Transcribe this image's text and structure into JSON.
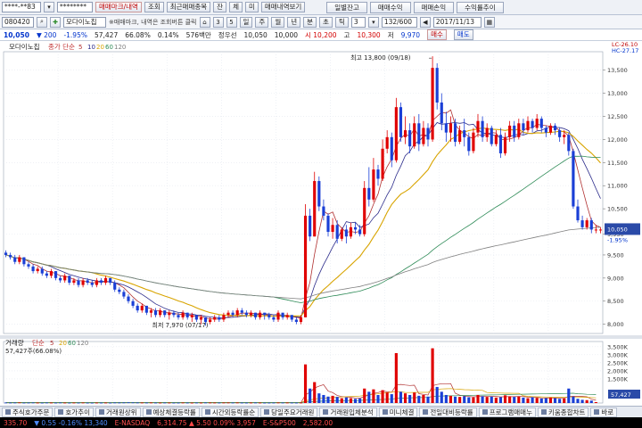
{
  "toolbar1": {
    "account": "****-**83",
    "password": "********",
    "btn_trade": "매매마크/내역",
    "btn_query": "조회",
    "btn_recent": "최근매매종목",
    "btn_balance": "잔",
    "btn_orders": "체",
    "btn_unfilled": "미",
    "btn_tradehist": "매매내역보기",
    "btn_daily": "일별잔고",
    "btn_profit": "매매수익",
    "btn_tradeprofit": "매매손익",
    "btn_yield": "수익률추이"
  },
  "toolbar2": {
    "code": "080420",
    "name": "모다이노칩",
    "note": "※매매마크, 내역은 조회버튼 클릭",
    "icon_labels": [
      "⌂",
      "3",
      "5"
    ],
    "btn_week": "일",
    "btn_min": "주",
    "btn_month": "월",
    "btn_year": "년",
    "btn_tick": "분",
    "btn_sec": "초",
    "btn_t": "틱",
    "min_value": "3",
    "count": "132/600",
    "date": "2017/11/13"
  },
  "quote": {
    "price": "10,050",
    "change": "200",
    "change_rate": "-1.95%",
    "volume": "57,427",
    "vol_ratio": "66.08%",
    "turnover": "0.14%",
    "amount": "576백만",
    "info": "정우선",
    "o": "10,050",
    "h": "10,000",
    "l": "시 10,200",
    "c_label": "고",
    "high": "10,300",
    "low_label": "저",
    "low": "9,970",
    "buy": "매수",
    "sell": "매도"
  },
  "price_panel": {
    "title": "모다이노칩",
    "ma_label": "종가 단순",
    "ma_periods": [
      "5",
      "10",
      "20",
      "60",
      "120"
    ],
    "lc_label": "LC-26.10",
    "hc_label": "HC-27.17",
    "high_annotation": "최고 13,800 (09/18)",
    "low_annotation": "최저 7,970 (07/17)",
    "last_price": "10,050",
    "last_rate": "-1.95%",
    "y_ticks": [
      "13,500",
      "13,000",
      "12,500",
      "12,000",
      "11,500",
      "11,000",
      "10,500",
      "9,950",
      "9,500",
      "9,000",
      "8,500",
      "8,000"
    ]
  },
  "volume_panel": {
    "title": "거래량",
    "ma_label": "단순",
    "ma_periods": [
      "5",
      "20",
      "60",
      "120"
    ],
    "value_label": "57,427주(66.08%)",
    "y_ticks": [
      "3,500K",
      "3,000K",
      "2,500K",
      "2,000K",
      "1,500K"
    ],
    "last_value": "57,427"
  },
  "tabs": [
    {
      "label": "주식호가주문"
    },
    {
      "label": "호가추이"
    },
    {
      "label": "거래원상위"
    },
    {
      "label": "예상체결등락률"
    },
    {
      "label": "시간외등락률순"
    },
    {
      "label": "당일주요거래원"
    },
    {
      "label": "거래원입체분석"
    },
    {
      "label": "미니체결"
    },
    {
      "label": "전일대비등락률"
    },
    {
      "label": "프로그램매매누"
    },
    {
      "label": "키움종합차트"
    },
    {
      "label": "바로"
    }
  ],
  "ticker": [
    {
      "text": "335.70",
      "cls": "tup"
    },
    {
      "text": "▼ 0.55  -0.16%  13,340",
      "cls": "tdn"
    },
    {
      "text": "E-NASDAQ",
      "cls": "tname"
    },
    {
      "text": "6,314.75  ▲ 5.50  0.09%  3,957",
      "cls": "tup"
    },
    {
      "text": "E-S&P500",
      "cls": "tname"
    },
    {
      "text": "2,582.00",
      "cls": "tup"
    }
  ],
  "colors": {
    "up": "#e00000",
    "down": "#1a3fd6",
    "ma5": "#b03030",
    "ma10": "#2a2a8a",
    "ma20": "#d8a400",
    "ma60": "#2e8b57",
    "ma120": "#808080"
  },
  "chart_data": {
    "type": "candlestick",
    "ylim": [
      7800,
      13900
    ],
    "bar_count": 132,
    "candles": [
      [
        9550,
        9600,
        9450,
        9500
      ],
      [
        9500,
        9550,
        9400,
        9450
      ],
      [
        9450,
        9500,
        9300,
        9350
      ],
      [
        9350,
        9500,
        9300,
        9450
      ],
      [
        9450,
        9450,
        9250,
        9300
      ],
      [
        9300,
        9350,
        9200,
        9250
      ],
      [
        9250,
        9300,
        9100,
        9150
      ],
      [
        9150,
        9250,
        9100,
        9200
      ],
      [
        9200,
        9250,
        9050,
        9100
      ],
      [
        9100,
        9150,
        9000,
        9050
      ],
      [
        9050,
        9200,
        9000,
        9150
      ],
      [
        9150,
        9150,
        8950,
        9000
      ],
      [
        9000,
        9050,
        8900,
        8950
      ],
      [
        8950,
        9100,
        8900,
        9050
      ],
      [
        9050,
        9050,
        8850,
        8900
      ],
      [
        8900,
        9000,
        8850,
        8950
      ],
      [
        8950,
        9000,
        8800,
        8850
      ],
      [
        8850,
        9000,
        8800,
        8950
      ],
      [
        8950,
        9000,
        8850,
        8900
      ],
      [
        8900,
        8950,
        8800,
        8850
      ],
      [
        8850,
        9000,
        8800,
        8950
      ],
      [
        8950,
        9000,
        8850,
        8900
      ],
      [
        8900,
        9050,
        8850,
        9000
      ],
      [
        9000,
        9000,
        8850,
        8900
      ],
      [
        8900,
        8950,
        8700,
        8750
      ],
      [
        8750,
        8800,
        8650,
        8700
      ],
      [
        8700,
        8750,
        8550,
        8600
      ],
      [
        8600,
        8650,
        8450,
        8500
      ],
      [
        8500,
        8550,
        8350,
        8400
      ],
      [
        8400,
        8450,
        8250,
        8300
      ],
      [
        8300,
        8450,
        8250,
        8400
      ],
      [
        8400,
        8400,
        8200,
        8250
      ],
      [
        8250,
        8350,
        8150,
        8300
      ],
      [
        8300,
        8350,
        8150,
        8200
      ],
      [
        8200,
        8350,
        8150,
        8300
      ],
      [
        8300,
        8300,
        8150,
        8200
      ],
      [
        8200,
        8300,
        8100,
        8250
      ],
      [
        8250,
        8300,
        8150,
        8200
      ],
      [
        8200,
        8250,
        8100,
        8150
      ],
      [
        8150,
        8300,
        8100,
        8250
      ],
      [
        8250,
        8250,
        8100,
        8150
      ],
      [
        8150,
        8250,
        8050,
        8200
      ],
      [
        8200,
        8200,
        8050,
        8100
      ],
      [
        8100,
        8200,
        8000,
        8150
      ],
      [
        8150,
        8150,
        7970,
        8050
      ],
      [
        8050,
        8150,
        8000,
        8100
      ],
      [
        8100,
        8200,
        8050,
        8150
      ],
      [
        8150,
        8200,
        8050,
        8100
      ],
      [
        8100,
        8250,
        8050,
        8200
      ],
      [
        8200,
        8300,
        8150,
        8250
      ],
      [
        8250,
        8300,
        8150,
        8200
      ],
      [
        8200,
        8350,
        8150,
        8300
      ],
      [
        8300,
        8350,
        8200,
        8250
      ],
      [
        8250,
        8300,
        8150,
        8200
      ],
      [
        8200,
        8300,
        8150,
        8250
      ],
      [
        8250,
        8250,
        8100,
        8150
      ],
      [
        8150,
        8300,
        8100,
        8250
      ],
      [
        8250,
        8250,
        8100,
        8200
      ],
      [
        8200,
        8250,
        8100,
        8150
      ],
      [
        8150,
        8200,
        8050,
        8100
      ],
      [
        8100,
        8300,
        8050,
        8250
      ],
      [
        8250,
        8250,
        8100,
        8150
      ],
      [
        8150,
        8250,
        8100,
        8200
      ],
      [
        8200,
        8200,
        8050,
        8100
      ],
      [
        8100,
        8150,
        8000,
        8050
      ],
      [
        8050,
        8200,
        8000,
        8150
      ],
      [
        8150,
        10600,
        8150,
        10350
      ],
      [
        10350,
        10500,
        9800,
        9900
      ],
      [
        9900,
        11300,
        9900,
        11100
      ],
      [
        11100,
        11200,
        10450,
        10550
      ],
      [
        10550,
        10700,
        10250,
        10350
      ],
      [
        10350,
        10400,
        9900,
        10000
      ],
      [
        10000,
        10300,
        9850,
        10150
      ],
      [
        10150,
        10250,
        9750,
        9850
      ],
      [
        9850,
        10100,
        9800,
        10050
      ],
      [
        10050,
        10150,
        9750,
        9900
      ],
      [
        9900,
        10200,
        9850,
        10100
      ],
      [
        10100,
        10200,
        9950,
        10050
      ],
      [
        10050,
        10150,
        9900,
        9950
      ],
      [
        9950,
        11100,
        9900,
        10950
      ],
      [
        10950,
        11400,
        10550,
        10700
      ],
      [
        10700,
        11600,
        10650,
        11350
      ],
      [
        11350,
        11450,
        11000,
        11150
      ],
      [
        11150,
        12000,
        11100,
        11800
      ],
      [
        11800,
        12200,
        11700,
        12050
      ],
      [
        12050,
        12150,
        11400,
        11550
      ],
      [
        11550,
        12900,
        11500,
        12700
      ],
      [
        12700,
        12800,
        11950,
        12050
      ],
      [
        12050,
        12500,
        11900,
        12200
      ],
      [
        12200,
        12350,
        11700,
        11850
      ],
      [
        11850,
        12500,
        11800,
        12350
      ],
      [
        12350,
        12550,
        11750,
        11900
      ],
      [
        11900,
        12400,
        11850,
        12250
      ],
      [
        12250,
        12350,
        11850,
        12000
      ],
      [
        12000,
        13800,
        11950,
        13550
      ],
      [
        13550,
        13650,
        12650,
        12800
      ],
      [
        12800,
        13000,
        12200,
        12350
      ],
      [
        12350,
        12600,
        11950,
        12150
      ],
      [
        12150,
        12500,
        11950,
        12350
      ],
      [
        12350,
        12450,
        11850,
        11950
      ],
      [
        11950,
        12300,
        11900,
        12200
      ],
      [
        12200,
        12450,
        11850,
        12050
      ],
      [
        12050,
        12150,
        11650,
        11750
      ],
      [
        11750,
        12250,
        11700,
        12150
      ],
      [
        12150,
        12550,
        12050,
        12400
      ],
      [
        12400,
        12500,
        11950,
        12050
      ],
      [
        12050,
        12350,
        11950,
        12250
      ],
      [
        12250,
        12300,
        11850,
        11900
      ],
      [
        11900,
        12200,
        11850,
        12100
      ],
      [
        12100,
        12250,
        11600,
        11700
      ],
      [
        11700,
        12150,
        11650,
        12050
      ],
      [
        12050,
        12400,
        11950,
        12300
      ],
      [
        12300,
        12400,
        11950,
        12050
      ],
      [
        12050,
        12450,
        12000,
        12350
      ],
      [
        12350,
        12450,
        12100,
        12200
      ],
      [
        12200,
        12500,
        12150,
        12400
      ],
      [
        12400,
        12450,
        12150,
        12250
      ],
      [
        12250,
        12550,
        12200,
        12450
      ],
      [
        12450,
        12500,
        12150,
        12250
      ],
      [
        12250,
        12300,
        12050,
        12150
      ],
      [
        12150,
        12350,
        12100,
        12300
      ],
      [
        12300,
        12350,
        12100,
        12200
      ],
      [
        12200,
        12250,
        11950,
        12050
      ],
      [
        12050,
        12200,
        11900,
        12100
      ],
      [
        12100,
        12150,
        11650,
        11750
      ],
      [
        11750,
        11800,
        10500,
        10550
      ],
      [
        10550,
        10700,
        10200,
        10250
      ],
      [
        10250,
        10350,
        10050,
        10100
      ],
      [
        10100,
        10300,
        10050,
        10250
      ],
      [
        10250,
        10300,
        9970,
        10050
      ],
      [
        10050,
        10150,
        9970,
        10050
      ],
      [
        10050,
        10100,
        9970,
        10050
      ]
    ],
    "volumes_k": [
      30,
      25,
      28,
      35,
      22,
      26,
      30,
      24,
      20,
      28,
      26,
      22,
      30,
      24,
      20,
      25,
      22,
      28,
      20,
      18,
      24,
      22,
      26,
      20,
      30,
      28,
      32,
      40,
      35,
      30,
      28,
      26,
      30,
      24,
      22,
      26,
      24,
      20,
      22,
      28,
      24,
      20,
      26,
      22,
      30,
      28,
      26,
      24,
      28,
      30,
      26,
      30,
      24,
      22,
      26,
      28,
      24,
      20,
      22,
      24,
      30,
      26,
      28,
      24,
      22,
      26,
      2400,
      900,
      1300,
      600,
      500,
      400,
      450,
      380,
      300,
      350,
      300,
      260,
      280,
      900,
      700,
      850,
      500,
      800,
      650,
      550,
      3100,
      700,
      600,
      500,
      650,
      450,
      500,
      400,
      3400,
      1000,
      700,
      500,
      450,
      400,
      380,
      420,
      360,
      350,
      500,
      420,
      380,
      400,
      340,
      360,
      480,
      420,
      380,
      400,
      340,
      300,
      360,
      320,
      280,
      300,
      340,
      300,
      260,
      280,
      900,
      400,
      260,
      200,
      180,
      150,
      57
    ]
  }
}
